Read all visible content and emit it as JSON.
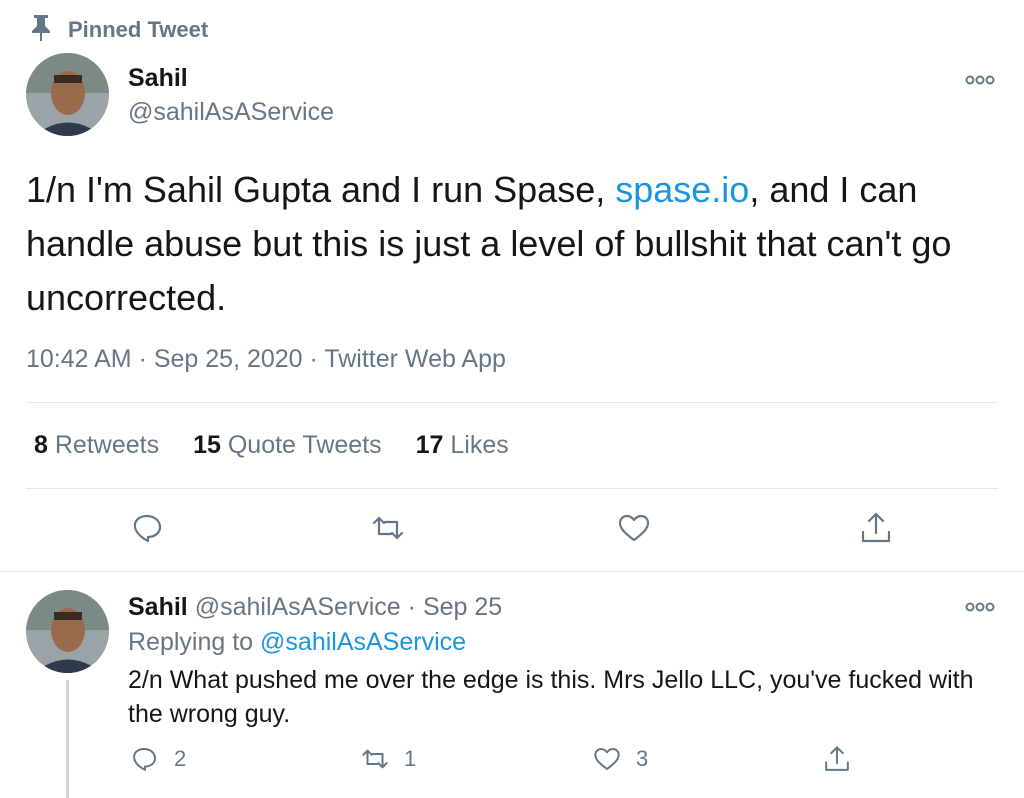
{
  "pinned": {
    "label": "Pinned Tweet"
  },
  "tweet": {
    "author_name": "Sahil",
    "author_handle": "@sahilAsAService",
    "text_before": "1/n I'm Sahil Gupta and I run Spase, ",
    "link": "spase.io",
    "text_after": ", and I can handle abuse but this is just a level of bullshit that can't go uncorrected.",
    "meta": "10:42 AM · Sep 25, 2020 · Twitter Web App",
    "stats": {
      "retweets_count": "8",
      "retweets_label": "Retweets",
      "quotes_count": "15",
      "quotes_label": "Quote Tweets",
      "likes_count": "17",
      "likes_label": "Likes"
    }
  },
  "reply": {
    "author_name": "Sahil",
    "author_handle": "@sahilAsAService",
    "separator": "·",
    "date": "Sep 25",
    "replying_prefix": "Replying to",
    "replying_handle": "@sahilAsAService",
    "text": "2/n What pushed me over the edge is this. Mrs Jello LLC, you've fucked with the wrong guy.",
    "reply_count": "2",
    "retweet_count": "1",
    "like_count": "3"
  },
  "colors": {
    "link": "#1b95e0",
    "secondary": "#657786",
    "icon": "#657786",
    "divider": "#e1e8ed"
  },
  "icons": [
    "pin-icon",
    "more-icon",
    "reply-icon",
    "retweet-icon",
    "like-icon",
    "share-icon"
  ]
}
